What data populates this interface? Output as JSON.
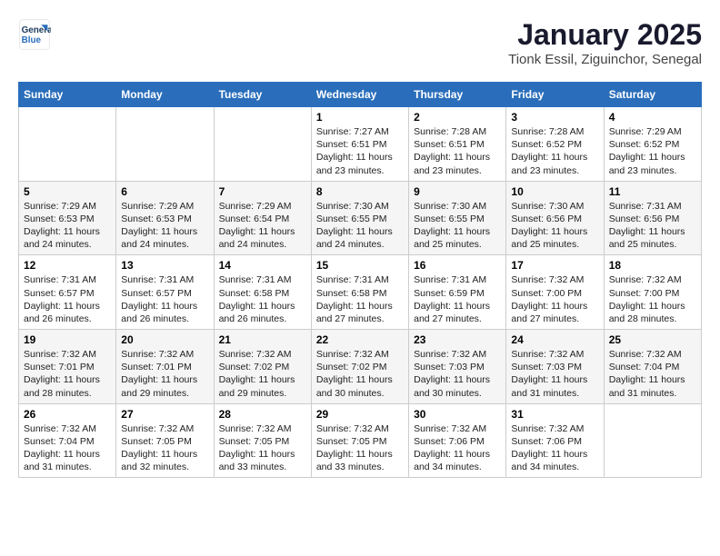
{
  "header": {
    "logo_line1": "General",
    "logo_line2": "Blue",
    "month": "January 2025",
    "location": "Tionk Essil, Ziguinchor, Senegal"
  },
  "columns": [
    "Sunday",
    "Monday",
    "Tuesday",
    "Wednesday",
    "Thursday",
    "Friday",
    "Saturday"
  ],
  "weeks": [
    [
      {
        "num": "",
        "info": ""
      },
      {
        "num": "",
        "info": ""
      },
      {
        "num": "",
        "info": ""
      },
      {
        "num": "1",
        "info": "Sunrise: 7:27 AM\nSunset: 6:51 PM\nDaylight: 11 hours\nand 23 minutes."
      },
      {
        "num": "2",
        "info": "Sunrise: 7:28 AM\nSunset: 6:51 PM\nDaylight: 11 hours\nand 23 minutes."
      },
      {
        "num": "3",
        "info": "Sunrise: 7:28 AM\nSunset: 6:52 PM\nDaylight: 11 hours\nand 23 minutes."
      },
      {
        "num": "4",
        "info": "Sunrise: 7:29 AM\nSunset: 6:52 PM\nDaylight: 11 hours\nand 23 minutes."
      }
    ],
    [
      {
        "num": "5",
        "info": "Sunrise: 7:29 AM\nSunset: 6:53 PM\nDaylight: 11 hours\nand 24 minutes."
      },
      {
        "num": "6",
        "info": "Sunrise: 7:29 AM\nSunset: 6:53 PM\nDaylight: 11 hours\nand 24 minutes."
      },
      {
        "num": "7",
        "info": "Sunrise: 7:29 AM\nSunset: 6:54 PM\nDaylight: 11 hours\nand 24 minutes."
      },
      {
        "num": "8",
        "info": "Sunrise: 7:30 AM\nSunset: 6:55 PM\nDaylight: 11 hours\nand 24 minutes."
      },
      {
        "num": "9",
        "info": "Sunrise: 7:30 AM\nSunset: 6:55 PM\nDaylight: 11 hours\nand 25 minutes."
      },
      {
        "num": "10",
        "info": "Sunrise: 7:30 AM\nSunset: 6:56 PM\nDaylight: 11 hours\nand 25 minutes."
      },
      {
        "num": "11",
        "info": "Sunrise: 7:31 AM\nSunset: 6:56 PM\nDaylight: 11 hours\nand 25 minutes."
      }
    ],
    [
      {
        "num": "12",
        "info": "Sunrise: 7:31 AM\nSunset: 6:57 PM\nDaylight: 11 hours\nand 26 minutes."
      },
      {
        "num": "13",
        "info": "Sunrise: 7:31 AM\nSunset: 6:57 PM\nDaylight: 11 hours\nand 26 minutes."
      },
      {
        "num": "14",
        "info": "Sunrise: 7:31 AM\nSunset: 6:58 PM\nDaylight: 11 hours\nand 26 minutes."
      },
      {
        "num": "15",
        "info": "Sunrise: 7:31 AM\nSunset: 6:58 PM\nDaylight: 11 hours\nand 27 minutes."
      },
      {
        "num": "16",
        "info": "Sunrise: 7:31 AM\nSunset: 6:59 PM\nDaylight: 11 hours\nand 27 minutes."
      },
      {
        "num": "17",
        "info": "Sunrise: 7:32 AM\nSunset: 7:00 PM\nDaylight: 11 hours\nand 27 minutes."
      },
      {
        "num": "18",
        "info": "Sunrise: 7:32 AM\nSunset: 7:00 PM\nDaylight: 11 hours\nand 28 minutes."
      }
    ],
    [
      {
        "num": "19",
        "info": "Sunrise: 7:32 AM\nSunset: 7:01 PM\nDaylight: 11 hours\nand 28 minutes."
      },
      {
        "num": "20",
        "info": "Sunrise: 7:32 AM\nSunset: 7:01 PM\nDaylight: 11 hours\nand 29 minutes."
      },
      {
        "num": "21",
        "info": "Sunrise: 7:32 AM\nSunset: 7:02 PM\nDaylight: 11 hours\nand 29 minutes."
      },
      {
        "num": "22",
        "info": "Sunrise: 7:32 AM\nSunset: 7:02 PM\nDaylight: 11 hours\nand 30 minutes."
      },
      {
        "num": "23",
        "info": "Sunrise: 7:32 AM\nSunset: 7:03 PM\nDaylight: 11 hours\nand 30 minutes."
      },
      {
        "num": "24",
        "info": "Sunrise: 7:32 AM\nSunset: 7:03 PM\nDaylight: 11 hours\nand 31 minutes."
      },
      {
        "num": "25",
        "info": "Sunrise: 7:32 AM\nSunset: 7:04 PM\nDaylight: 11 hours\nand 31 minutes."
      }
    ],
    [
      {
        "num": "26",
        "info": "Sunrise: 7:32 AM\nSunset: 7:04 PM\nDaylight: 11 hours\nand 31 minutes."
      },
      {
        "num": "27",
        "info": "Sunrise: 7:32 AM\nSunset: 7:05 PM\nDaylight: 11 hours\nand 32 minutes."
      },
      {
        "num": "28",
        "info": "Sunrise: 7:32 AM\nSunset: 7:05 PM\nDaylight: 11 hours\nand 33 minutes."
      },
      {
        "num": "29",
        "info": "Sunrise: 7:32 AM\nSunset: 7:05 PM\nDaylight: 11 hours\nand 33 minutes."
      },
      {
        "num": "30",
        "info": "Sunrise: 7:32 AM\nSunset: 7:06 PM\nDaylight: 11 hours\nand 34 minutes."
      },
      {
        "num": "31",
        "info": "Sunrise: 7:32 AM\nSunset: 7:06 PM\nDaylight: 11 hours\nand 34 minutes."
      },
      {
        "num": "",
        "info": ""
      }
    ]
  ]
}
